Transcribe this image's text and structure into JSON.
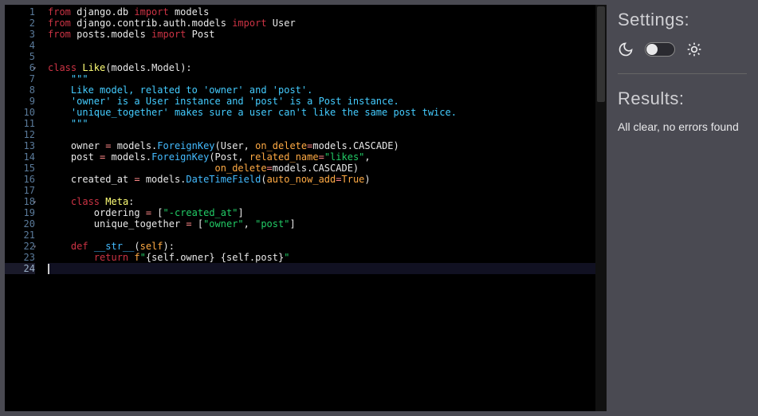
{
  "settings": {
    "heading": "Settings:",
    "theme_toggle_state": "dark"
  },
  "results": {
    "heading": "Results:",
    "message": "All clear, no errors found"
  },
  "editor": {
    "active_line": 24,
    "fold_lines": [
      6,
      18,
      22
    ],
    "lines": [
      [
        {
          "t": "from ",
          "c": "kw"
        },
        {
          "t": "django.db ",
          "c": "mod"
        },
        {
          "t": "import ",
          "c": "kw"
        },
        {
          "t": "models",
          "c": "mod"
        }
      ],
      [
        {
          "t": "from ",
          "c": "kw"
        },
        {
          "t": "django.contrib.auth.models ",
          "c": "mod"
        },
        {
          "t": "import ",
          "c": "kw"
        },
        {
          "t": "User",
          "c": "mod"
        }
      ],
      [
        {
          "t": "from ",
          "c": "kw"
        },
        {
          "t": "posts.models ",
          "c": "mod"
        },
        {
          "t": "import ",
          "c": "kw"
        },
        {
          "t": "Post",
          "c": "mod"
        }
      ],
      [],
      [],
      [
        {
          "t": "class ",
          "c": "kw"
        },
        {
          "t": "Like",
          "c": "cls"
        },
        {
          "t": "(",
          "c": "punct"
        },
        {
          "t": "models.Model",
          "c": "mod"
        },
        {
          "t": "):",
          "c": "punct"
        }
      ],
      [
        {
          "t": "    ",
          "c": ""
        },
        {
          "t": "\"\"\"",
          "c": "cmt"
        }
      ],
      [
        {
          "t": "    ",
          "c": ""
        },
        {
          "t": "Like model, related to 'owner' and 'post'.",
          "c": "cmt"
        }
      ],
      [
        {
          "t": "    ",
          "c": ""
        },
        {
          "t": "'owner' is a User instance and 'post' is a Post instance.",
          "c": "cmt"
        }
      ],
      [
        {
          "t": "    ",
          "c": ""
        },
        {
          "t": "'unique_together' makes sure a user can't like the same post twice.",
          "c": "cmt"
        }
      ],
      [
        {
          "t": "    ",
          "c": ""
        },
        {
          "t": "\"\"\"",
          "c": "cmt"
        }
      ],
      [],
      [
        {
          "t": "    owner ",
          "c": "mod"
        },
        {
          "t": "= ",
          "c": "op"
        },
        {
          "t": "models.",
          "c": "mod"
        },
        {
          "t": "ForeignKey",
          "c": "fn"
        },
        {
          "t": "(User, ",
          "c": "mod"
        },
        {
          "t": "on_delete",
          "c": "param"
        },
        {
          "t": "=",
          "c": "op"
        },
        {
          "t": "models.CASCADE)",
          "c": "mod"
        }
      ],
      [
        {
          "t": "    post ",
          "c": "mod"
        },
        {
          "t": "= ",
          "c": "op"
        },
        {
          "t": "models.",
          "c": "mod"
        },
        {
          "t": "ForeignKey",
          "c": "fn"
        },
        {
          "t": "(Post, ",
          "c": "mod"
        },
        {
          "t": "related_name",
          "c": "param"
        },
        {
          "t": "=",
          "c": "op"
        },
        {
          "t": "\"likes\"",
          "c": "str"
        },
        {
          "t": ",",
          "c": "mod"
        }
      ],
      [
        {
          "t": "                             ",
          "c": ""
        },
        {
          "t": "on_delete",
          "c": "param"
        },
        {
          "t": "=",
          "c": "op"
        },
        {
          "t": "models.CASCADE)",
          "c": "mod"
        }
      ],
      [
        {
          "t": "    created_at ",
          "c": "mod"
        },
        {
          "t": "= ",
          "c": "op"
        },
        {
          "t": "models.",
          "c": "mod"
        },
        {
          "t": "DateTimeField",
          "c": "fn"
        },
        {
          "t": "(",
          "c": "mod"
        },
        {
          "t": "auto_now_add",
          "c": "param"
        },
        {
          "t": "=",
          "c": "op"
        },
        {
          "t": "True",
          "c": "builtin"
        },
        {
          "t": ")",
          "c": "mod"
        }
      ],
      [],
      [
        {
          "t": "    ",
          "c": ""
        },
        {
          "t": "class ",
          "c": "kw"
        },
        {
          "t": "Meta",
          "c": "cls"
        },
        {
          "t": ":",
          "c": "punct"
        }
      ],
      [
        {
          "t": "        ordering ",
          "c": "mod"
        },
        {
          "t": "= ",
          "c": "op"
        },
        {
          "t": "[",
          "c": "punct"
        },
        {
          "t": "\"-created_at\"",
          "c": "str"
        },
        {
          "t": "]",
          "c": "punct"
        }
      ],
      [
        {
          "t": "        unique_together ",
          "c": "mod"
        },
        {
          "t": "= ",
          "c": "op"
        },
        {
          "t": "[",
          "c": "punct"
        },
        {
          "t": "\"owner\"",
          "c": "str"
        },
        {
          "t": ", ",
          "c": "punct"
        },
        {
          "t": "\"post\"",
          "c": "str"
        },
        {
          "t": "]",
          "c": "punct"
        }
      ],
      [],
      [
        {
          "t": "    ",
          "c": ""
        },
        {
          "t": "def ",
          "c": "kw"
        },
        {
          "t": "__str__",
          "c": "fn"
        },
        {
          "t": "(",
          "c": "punct"
        },
        {
          "t": "self",
          "c": "builtin"
        },
        {
          "t": "):",
          "c": "punct"
        }
      ],
      [
        {
          "t": "        ",
          "c": ""
        },
        {
          "t": "return ",
          "c": "kw"
        },
        {
          "t": "f",
          "c": "builtin"
        },
        {
          "t": "\"",
          "c": "str"
        },
        {
          "t": "{self.owner}",
          "c": "mod"
        },
        {
          "t": " ",
          "c": "str"
        },
        {
          "t": "{self.post}",
          "c": "mod"
        },
        {
          "t": "\"",
          "c": "str"
        }
      ],
      []
    ]
  }
}
